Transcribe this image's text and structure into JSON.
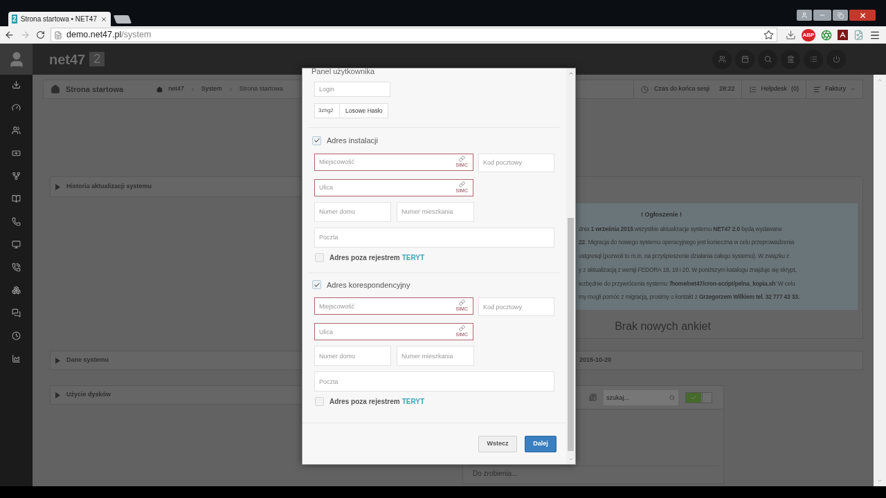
{
  "browser": {
    "tab_title": "Strona startowa • NET47",
    "favicon": "2",
    "url_host": "demo.net47.pl",
    "url_path": "/system",
    "adblock_badge": "ABP"
  },
  "header": {
    "logo": "net47",
    "logo_badge": "2"
  },
  "toolbar": {
    "page_title": "Strona startowa",
    "breadcrumb": [
      "net47",
      "System",
      "Strona startowa"
    ],
    "session_label": "Czas do końca sesji",
    "session_time": "28:22",
    "helpdesk": "Helpdesk",
    "helpdesk_count": "(0)",
    "invoices": "Faktury"
  },
  "panels": {
    "history": "Historia aktualizacji systemu",
    "system": "Dane systemu",
    "system_date": "2015-10-20",
    "disks": "Użycie dysków"
  },
  "announcement": {
    "heading": "! Ogłoszenie !",
    "lines": [
      "dnia **1 września 2015** wszystkie aktualizacje systemu **NET47 2.0** będą wydawane",
      "**22**. Migracja do nowego systemu operacyjnego jest konieczna w celu przeprowadzenia",
      "ostgresql (pozwoli to m.in. na przyśpieszenie działania całego systemu). W związku z",
      "y z aktualizacją z wersji FEDORA 18, 19 i 20. W poniższym katalogu znajduje się skrypt,",
      "iezbędnie do przywrócenia systemu '**/home/net47/cron-script/pelna_kopia.sh**' W celu",
      "my mogli pomóc z migracją, prosimy o kontakt z **Grzegorzem Wilkiem tel. 32 777 43 33.**"
    ]
  },
  "surveys": "Brak nowych ankiet",
  "todo": {
    "search_placeholder": "szukaj...",
    "toggle_on": true,
    "input_placeholder": "Do zrobienia..."
  },
  "modal": {
    "title": "Panel użytkownika",
    "login_placeholder": "Login",
    "password_value": "3zhg2",
    "random_password_button": "Losowe Hasło",
    "sections": [
      {
        "label": "Adres instalacji",
        "checked": true,
        "fields": [
          {
            "placeholder": "Miejscowość",
            "invalid": true,
            "addon": "SIMC"
          },
          {
            "placeholder": "Kod pocztowy",
            "invalid": false
          },
          {
            "placeholder": "Ulica",
            "invalid": true,
            "addon": "SIMC"
          },
          {
            "placeholder": "Numer domu",
            "invalid": false
          },
          {
            "placeholder": "Numer mieszkania",
            "invalid": false
          },
          {
            "placeholder": "Poczta",
            "invalid": false
          }
        ],
        "outside_checked": false,
        "outside_label": "Adres poza rejestrem",
        "outside_link": "TERYT"
      },
      {
        "label": "Adres korespondencyjny",
        "checked": true,
        "fields": [
          {
            "placeholder": "Miejscowość",
            "invalid": true,
            "addon": "SIMC"
          },
          {
            "placeholder": "Kod pocztowy",
            "invalid": false
          },
          {
            "placeholder": "Ulica",
            "invalid": true,
            "addon": "SIMC"
          },
          {
            "placeholder": "Numer domu",
            "invalid": false
          },
          {
            "placeholder": "Numer mieszkania",
            "invalid": false
          },
          {
            "placeholder": "Poczta",
            "invalid": false
          }
        ],
        "outside_checked": false,
        "outside_label": "Adres poza rejestrem",
        "outside_link": "TERYT"
      }
    ],
    "back_button": "Wstecz",
    "next_button": "Dalej"
  }
}
